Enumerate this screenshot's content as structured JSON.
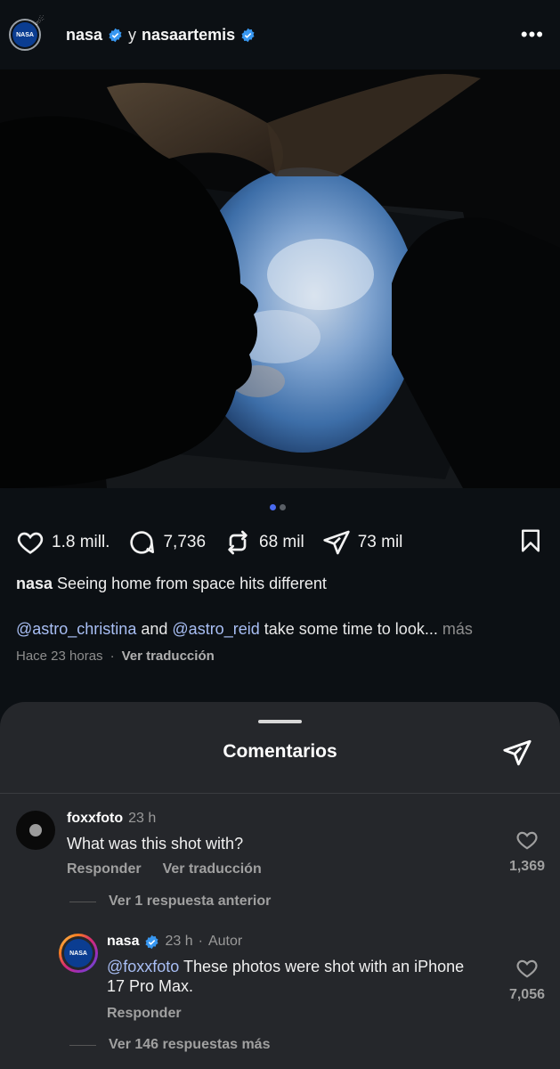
{
  "header": {
    "account1": "nasa",
    "conjunction": "y",
    "account2": "nasaartemis",
    "avatar_label": "NASA"
  },
  "stats": {
    "likes": "1.8 mill.",
    "comments": "7,736",
    "reposts": "68 mil",
    "shares": "73 mil"
  },
  "caption": {
    "username": "nasa",
    "text": "Seeing home from space hits different",
    "mention1": "@astro_christina",
    "and": "and",
    "mention2": "@astro_reid",
    "rest": "take some time to look...",
    "more": "más",
    "time": "Hace 23 horas",
    "separator": "·",
    "translate": "Ver traducción"
  },
  "sheet": {
    "title": "Comentarios"
  },
  "comments": [
    {
      "username": "foxxfoto",
      "time": "23 h",
      "text": "What was this shot with?",
      "reply_label": "Responder",
      "translate_label": "Ver traducción",
      "likes": "1,369"
    }
  ],
  "view_prev": "Ver 1 respuesta anterior",
  "reply": {
    "username": "nasa",
    "time": "23 h",
    "dot": "·",
    "author": "Autor",
    "mention": "@foxxfoto",
    "text": "These photos were shot with an iPhone 17 Pro Max.",
    "reply_label": "Responder",
    "likes": "7,056",
    "avatar_label": "NASA"
  },
  "view_more": "Ver 146 respuestas más",
  "colors": {
    "background": "#0c1014",
    "sheet": "#25272b",
    "mention": "#a9bff5",
    "verified": "#3897f0",
    "active_dot": "#4a6bf0"
  }
}
